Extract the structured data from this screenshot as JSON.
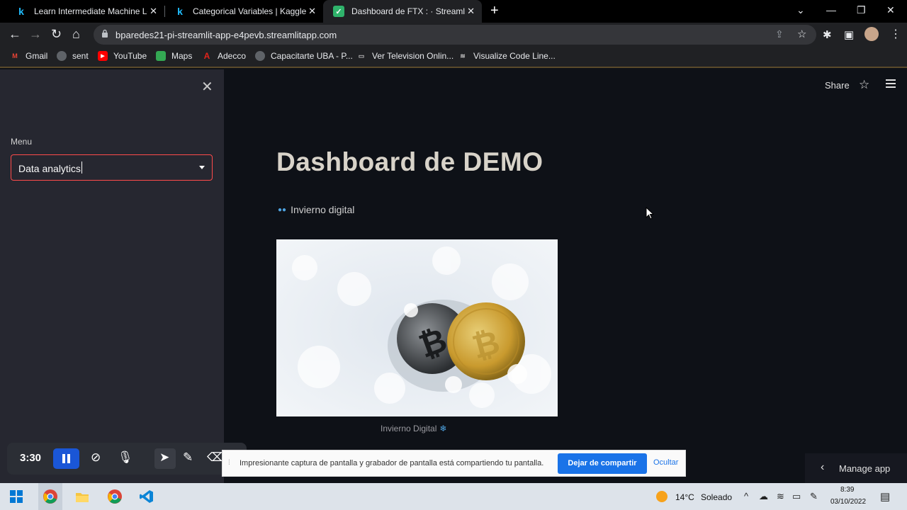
{
  "browser": {
    "tabs": [
      {
        "title": "Learn Intermediate Machine Lear",
        "favicon": "k",
        "active": false
      },
      {
        "title": "Categorical Variables | Kaggle",
        "favicon": "k",
        "active": false
      },
      {
        "title": "Dashboard de FTX : · Streamlit",
        "favicon": "check",
        "active": true
      }
    ],
    "url": "bparedes21-pi-streamlit-app-e4pevb.streamlitapp.com",
    "bookmarks": [
      "Gmail",
      "sent",
      "YouTube",
      "Maps",
      "Adecco",
      "Capacitarte UBA - P...",
      "Ver Television Onlin...",
      "Visualize Code Line..."
    ]
  },
  "sidebar": {
    "menu_label": "Menu",
    "menu_value": "Data analytics"
  },
  "main": {
    "share_label": "Share",
    "title": "Dashboard de DEMO",
    "subheader": "Invierno digital",
    "caption": "Invierno Digital"
  },
  "recorder": {
    "time": "3:30",
    "notice": "Impresionante captura de pantalla y grabador de pantalla está compartiendo tu pantalla.",
    "stop_label": "Dejar de compartir",
    "hide_label": "Ocultar"
  },
  "manage_app_label": "Manage app",
  "taskbar": {
    "temperature": "14°C",
    "weather": "Soleado",
    "time": "8:39",
    "date": "03/10/2022"
  },
  "colors": {
    "accent": "#ff4b4b",
    "sidebar_bg": "#262730",
    "main_bg": "#0e1117",
    "share_button": "#1a73e8"
  }
}
